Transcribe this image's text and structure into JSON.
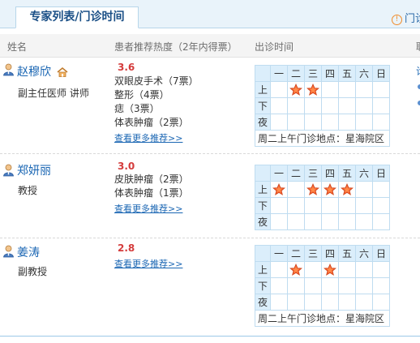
{
  "tab": {
    "title": "专家列表/门诊时间"
  },
  "notice": {
    "text": "门诊"
  },
  "columns": {
    "name": "姓名",
    "recommend": "患者推荐热度（2年内得票）",
    "schedule": "出诊时间",
    "extra": "联"
  },
  "schedule_header": {
    "days": [
      "一",
      "二",
      "三",
      "四",
      "五",
      "六",
      "日"
    ],
    "periods": [
      "上",
      "下",
      "夜"
    ]
  },
  "doctors": [
    {
      "name": "赵穆欣",
      "title": "副主任医师 讲师",
      "score": "3.6",
      "recommendations": [
        "双眼皮手术（7票）",
        "整形（4票）",
        "痣（3票）",
        "体表肿瘤（2票）"
      ],
      "more": "查看更多推荐>>",
      "location": "周二上午门诊地点：星海院区",
      "side": "诊"
    },
    {
      "name": "郑妍丽",
      "title": "教授",
      "score": "3.0",
      "recommendations": [
        "皮肤肿瘤（2票）",
        "体表肿瘤（1票）"
      ],
      "more": "查看更多推荐>>"
    },
    {
      "name": "姜涛",
      "title": "副教授",
      "score": "2.8",
      "recommendations": [],
      "more": "查看更多推荐>>",
      "location": "周二上午门诊地点：星海院区"
    }
  ]
}
